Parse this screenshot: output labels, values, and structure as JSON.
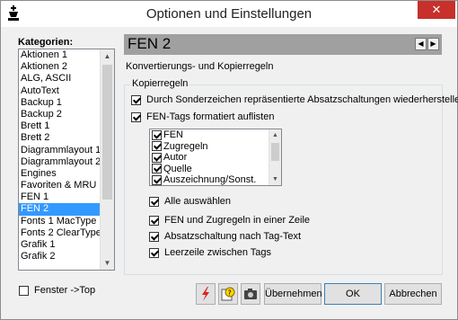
{
  "window": {
    "title": "Optionen und Einstellungen",
    "close_glyph": "✕"
  },
  "categories": {
    "label": "Kategorien:",
    "items": [
      "Aktionen 1",
      "Aktionen 2",
      "ALG, ASCII",
      "AutoText",
      "Backup 1",
      "Backup 2",
      "Brett 1",
      "Brett 2",
      "Diagrammlayout 1",
      "Diagrammlayout 2",
      "Engines",
      "Favoriten & MRU",
      "FEN 1",
      "FEN 2",
      "Fonts 1 MacType",
      "Fonts 2 ClearType",
      "Grafik 1",
      "Grafik 2"
    ],
    "selected_index": 13
  },
  "fenster_top": {
    "label": "Fenster ->Top",
    "checked": false
  },
  "panel": {
    "title": "FEN 2",
    "subtitle": "Konvertierungs- und Kopierregeln",
    "group_label": "Kopierregeln",
    "options": [
      {
        "label": "Durch Sonderzeichen repräsentierte Absatzschaltungen wiederherstellen",
        "checked": true
      },
      {
        "label": "FEN-Tags formatiert auflisten",
        "checked": true
      }
    ],
    "tag_list": [
      {
        "label": "FEN",
        "checked": true
      },
      {
        "label": "Zugregeln",
        "checked": true
      },
      {
        "label": "Autor",
        "checked": true
      },
      {
        "label": "Quelle",
        "checked": true
      },
      {
        "label": "Auszeichnung/Sonst.",
        "checked": true
      }
    ],
    "sub_options": [
      {
        "label": "Alle auswählen",
        "checked": true
      },
      {
        "label": "FEN und Zugregeln in einer Zeile",
        "checked": true
      },
      {
        "label": "Absatzschaltung nach Tag-Text",
        "checked": true
      },
      {
        "label": "Leerzeile zwischen Tags",
        "checked": true
      }
    ]
  },
  "buttons": {
    "ubernehmen": "Übernehmen",
    "ok": "OK",
    "abbrechen": "Abbrechen"
  },
  "colors": {
    "selection": "#3399ff",
    "close": "#c7302b",
    "header": "#a0a0a0"
  }
}
